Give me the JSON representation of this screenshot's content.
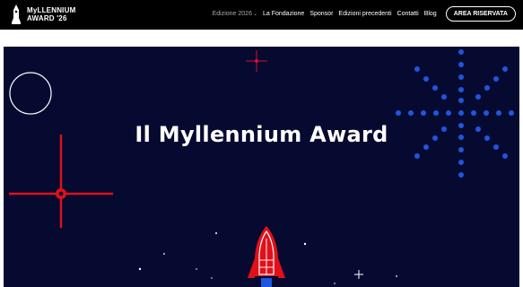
{
  "header": {
    "logo_line1": "MyLLENNIUM",
    "logo_line2": "AWARD '26",
    "nav": {
      "edition": "Edizione 2026",
      "foundation": "La Fondazione",
      "sponsor": "Sponsor",
      "previous": "Edizioni precedenti",
      "contacts": "Contatti",
      "blog": "Blog",
      "reserved_area": "AREA RISERVATA"
    }
  },
  "hero": {
    "title": "Il Myllennium Award"
  },
  "colors": {
    "header_bg": "#000000",
    "hero_bg": "#070a30",
    "accent_red": "#e0101a",
    "accent_blue": "#1f55e0",
    "text_white": "#ffffff"
  },
  "icons": {
    "logo": "trophy-rocket-icon",
    "edition_dropdown": "chevron-down-icon"
  }
}
